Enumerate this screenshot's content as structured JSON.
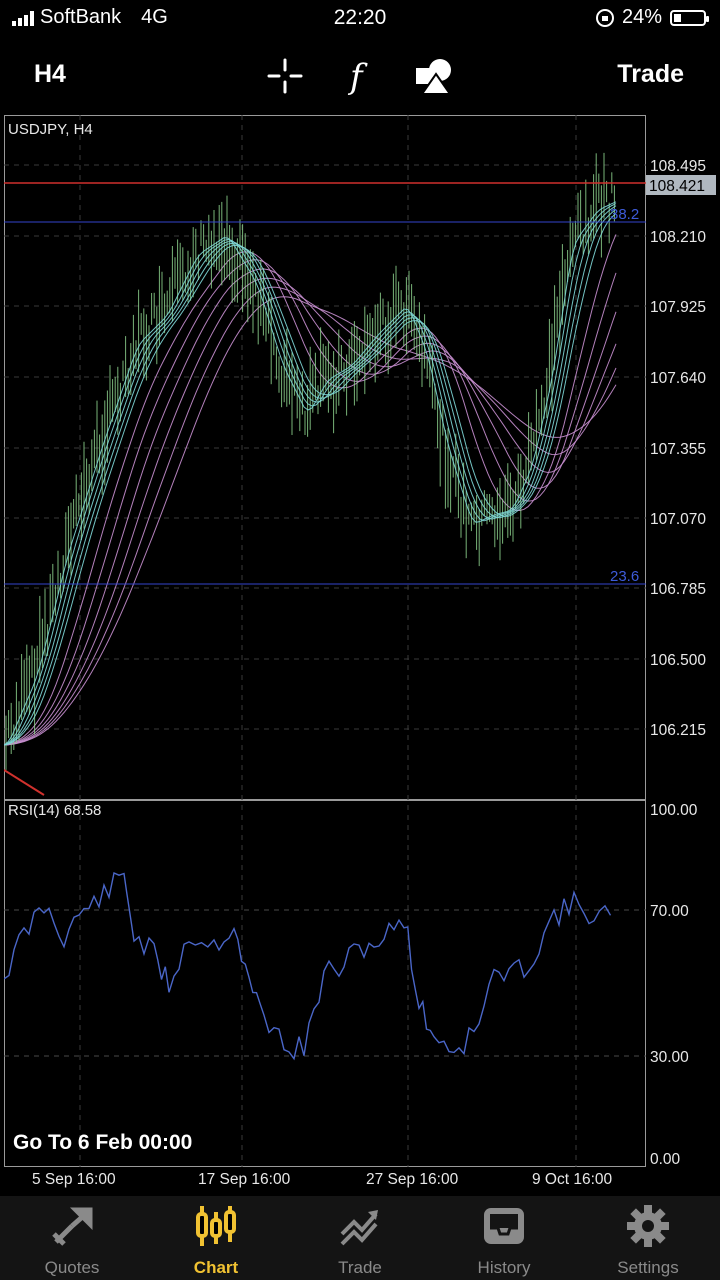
{
  "status_bar": {
    "carrier": "SoftBank",
    "network": "4G",
    "time": "22:20",
    "battery": "24%",
    "battery_level": 0.24
  },
  "toolbar": {
    "timeframe": "H4",
    "trade_label": "Trade",
    "icons": [
      "crosshair-icon",
      "function-icon",
      "objects-icon"
    ]
  },
  "chart": {
    "symbol_label": "USDJPY, H4",
    "price_levels": [
      "108.495",
      "108.210",
      "107.925",
      "107.640",
      "107.355",
      "107.070",
      "106.785",
      "106.500",
      "106.215"
    ],
    "current_price": "108.421",
    "fib_levels": [
      "38.2",
      "23.6"
    ],
    "rsi_label": "RSI(14) 68.58",
    "rsi_levels": [
      "100.00",
      "70.00",
      "30.00",
      "0.00"
    ],
    "time_labels": [
      "5 Sep 16:00",
      "17 Sep 16:00",
      "27 Sep 16:00",
      "9 Oct 16:00"
    ],
    "goto_text": "Go To 6 Feb 00:00",
    "colors": {
      "bid_line": "#d0312d",
      "fib_line": "#3344cc",
      "rsi_line": "#4a66c8",
      "candle": "#8fd38f",
      "ma_fast": "#7fd8d8",
      "ma_slow": "#c88fd0"
    }
  },
  "tabs": [
    {
      "label": "Quotes",
      "icon": "quotes-icon",
      "active": false
    },
    {
      "label": "Chart",
      "icon": "chart-icon",
      "active": true
    },
    {
      "label": "Trade",
      "icon": "trade-icon",
      "active": false
    },
    {
      "label": "History",
      "icon": "history-icon",
      "active": false
    },
    {
      "label": "Settings",
      "icon": "gear-icon",
      "active": false
    }
  ]
}
